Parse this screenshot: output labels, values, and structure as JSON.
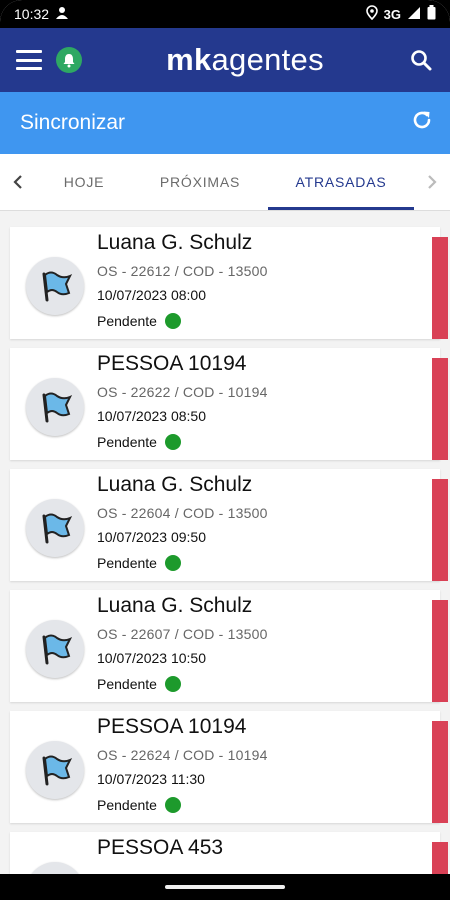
{
  "status_bar": {
    "time": "10:32",
    "network": "3G"
  },
  "app_bar": {
    "logo_bold": "mk",
    "logo_rest": "agentes"
  },
  "sync_bar": {
    "label": "Sincronizar"
  },
  "tabs": [
    {
      "label": "HOJE",
      "active": false
    },
    {
      "label": "PRÓXIMAS",
      "active": false
    },
    {
      "label": "ATRASADAS",
      "active": true
    }
  ],
  "items": [
    {
      "name": "Luana G. Schulz",
      "os": "OS - 22612 / COD - 13500",
      "datetime": "10/07/2023 08:00",
      "status": "Pendente"
    },
    {
      "name": "PESSOA 10194",
      "os": "OS - 22622 / COD - 10194",
      "datetime": "10/07/2023 08:50",
      "status": "Pendente"
    },
    {
      "name": "Luana G. Schulz",
      "os": "OS - 22604 / COD - 13500",
      "datetime": "10/07/2023 09:50",
      "status": "Pendente"
    },
    {
      "name": "Luana G. Schulz",
      "os": "OS - 22607 / COD - 13500",
      "datetime": "10/07/2023 10:50",
      "status": "Pendente"
    },
    {
      "name": "PESSOA 10194",
      "os": "OS - 22624 / COD - 10194",
      "datetime": "10/07/2023 11:30",
      "status": "Pendente"
    },
    {
      "name": "PESSOA 453",
      "os": "",
      "datetime": "",
      "status": ""
    }
  ],
  "colors": {
    "app_bar": "#24398e",
    "sync_bar": "#3f96f0",
    "late_stripe": "#d94156",
    "status_dot": "#1d9a2c",
    "notification_badge": "#2ea863"
  },
  "icons": [
    "person-icon",
    "location-icon",
    "wifi-icon",
    "signal-icon",
    "battery-icon",
    "menu-icon",
    "bell-icon",
    "search-icon",
    "refresh-icon",
    "chevron-left-icon",
    "chevron-right-icon",
    "flag-icon"
  ]
}
